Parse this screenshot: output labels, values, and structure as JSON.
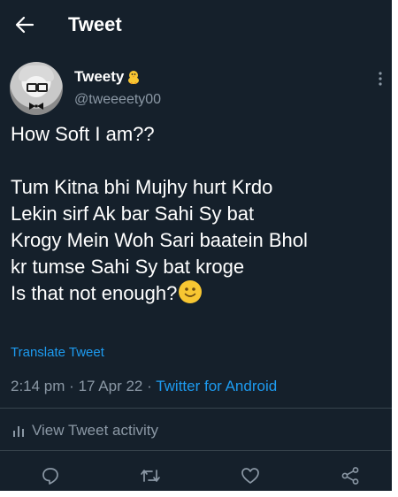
{
  "header": {
    "title": "Tweet",
    "back_icon": "arrow-left-icon"
  },
  "author": {
    "name": "Tweety",
    "name_emoji": "baby-chick-icon",
    "handle": "@tweeeety00"
  },
  "tweet": {
    "lines": [
      "How Soft I am??",
      "",
      "Tum Kitna bhi Mujhy hurt Krdo",
      "Lekin sirf Ak bar Sahi Sy bat",
      "Krogy Mein Woh Sari baatein Bhol",
      "kr tumse Sahi Sy bat kroge",
      "Is that not enough?"
    ],
    "trailing_emoji": "slightly-smiling-face-icon",
    "translate_label": "Translate Tweet"
  },
  "meta": {
    "time": "2:14 pm",
    "separator": "·",
    "date": "17 Apr 22",
    "source": "Twitter for Android"
  },
  "activity": {
    "label": "View Tweet activity",
    "icon": "bar-chart-icon"
  },
  "actions": [
    {
      "name": "reply",
      "icon": "reply-icon"
    },
    {
      "name": "retweet",
      "icon": "retweet-icon"
    },
    {
      "name": "like",
      "icon": "heart-icon"
    },
    {
      "name": "share",
      "icon": "share-icon"
    }
  ],
  "colors": {
    "background": "#15202b",
    "text": "#ffffff",
    "secondary_text": "#8b98a5",
    "accent": "#1d9bf0",
    "divider": "#38444d"
  }
}
